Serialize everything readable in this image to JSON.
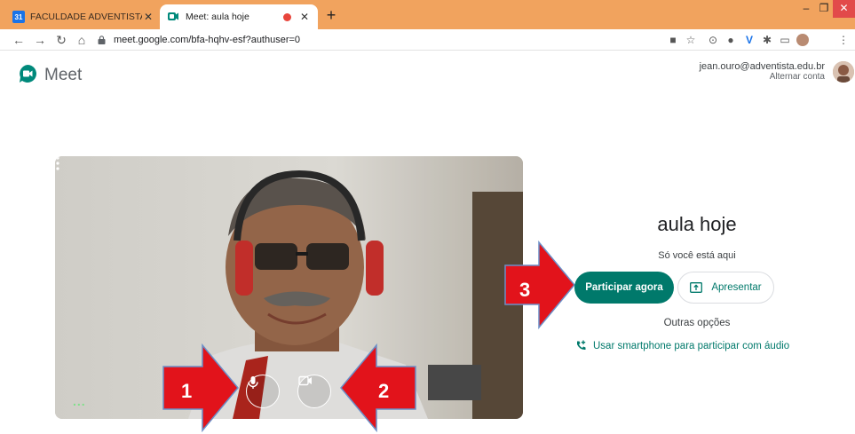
{
  "browser": {
    "tabs": [
      {
        "title": "FACULDADE ADVENTISTA DA BA",
        "favicon_text": "31",
        "active": false
      },
      {
        "title": "Meet: aula hoje",
        "active": true,
        "recording": true
      }
    ],
    "new_tab_label": "+",
    "window_controls": {
      "minimize": "–",
      "maximize": "❐",
      "close": "✕"
    },
    "url": "meet.google.com/bfa-hqhv-esf?authuser=0",
    "extension_icons": [
      "camera-icon",
      "star-icon",
      "extension-1-icon",
      "extension-2-icon",
      "extension-3-icon",
      "puzzle-icon",
      "cast-icon",
      "profile-icon",
      "menu-icon"
    ]
  },
  "meet": {
    "app_name": "Meet",
    "account_email": "jean.ouro@adventista.edu.br",
    "switch_account": "Alternar conta",
    "meeting_name": "aula hoje",
    "presence_text": "Só você está aqui",
    "join_label": "Participar agora",
    "present_label": "Apresentar",
    "other_options": "Outras opções",
    "phone_link": "Usar smartphone para participar com áudio",
    "accent_color": "#00796b",
    "more_dots": "..."
  },
  "annotations": [
    {
      "number": "1"
    },
    {
      "number": "2"
    },
    {
      "number": "3"
    }
  ]
}
